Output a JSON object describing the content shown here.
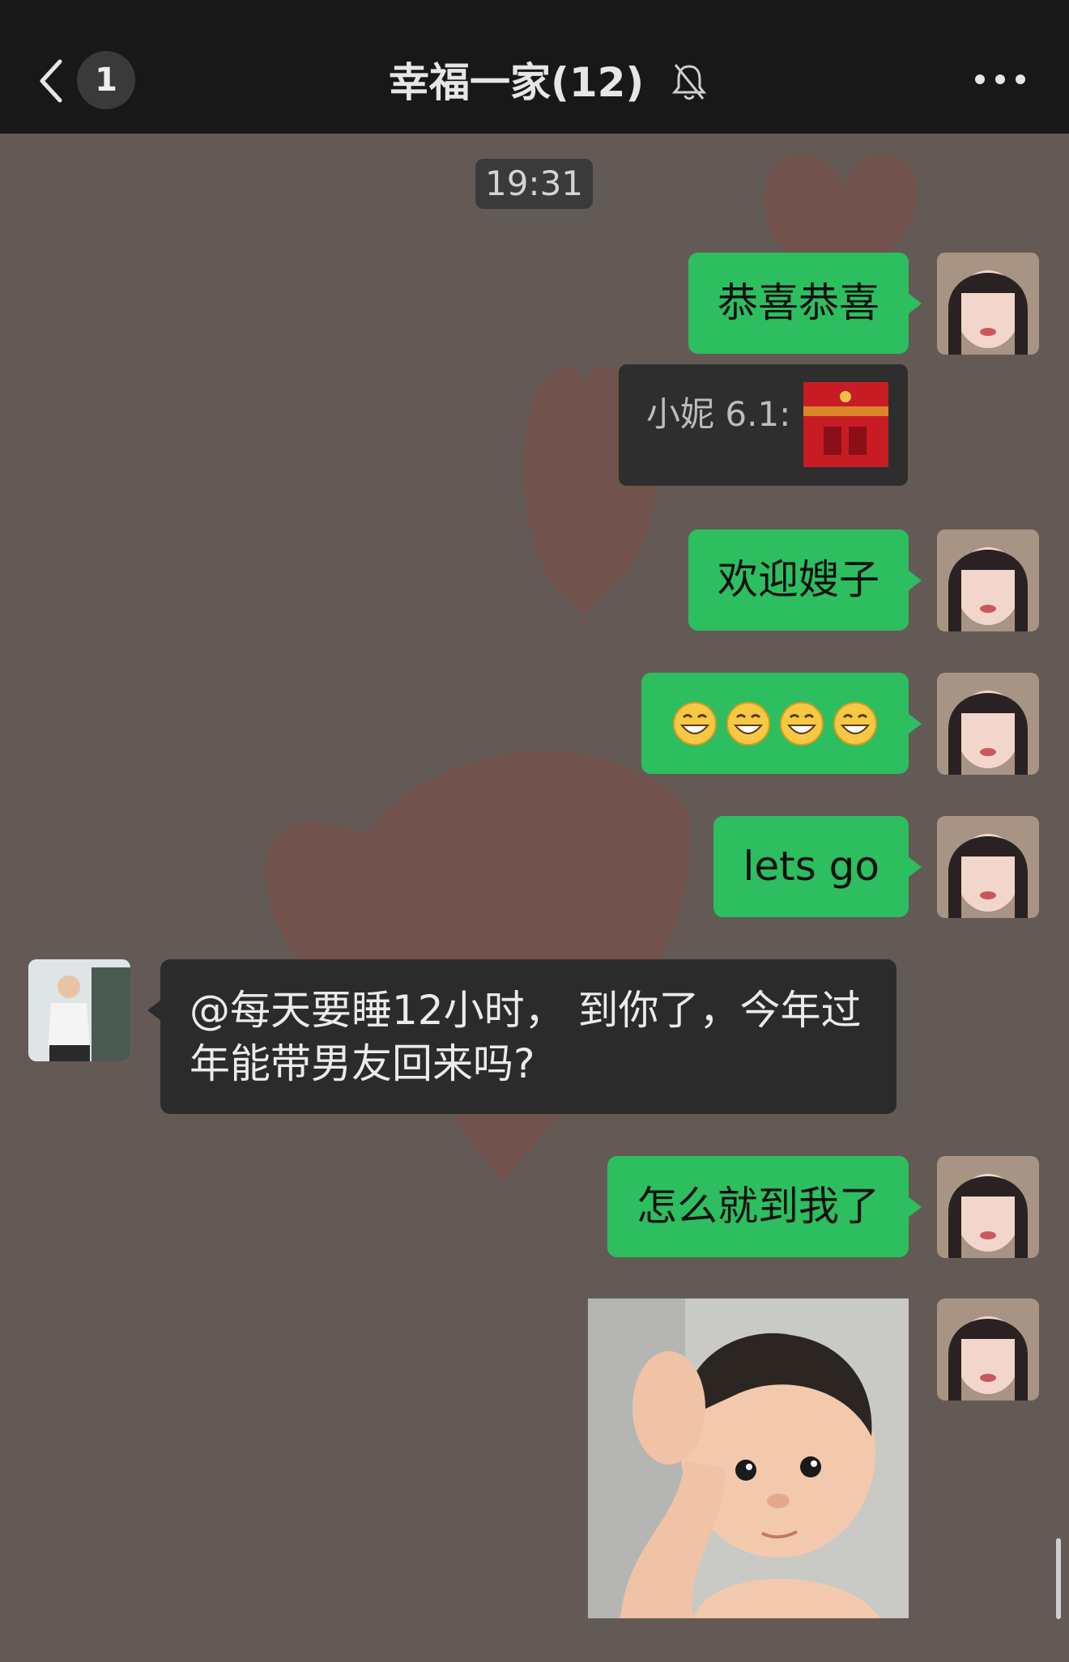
{
  "header": {
    "back_icon": "chevron-left-icon",
    "unread_count": "1",
    "title": "幸福一家(12)",
    "mute_icon": "bell-muted-icon",
    "more_icon": "ellipsis-icon"
  },
  "timestamp": "19:31",
  "messages": {
    "m1": {
      "sender": "self",
      "text": "恭喜恭喜"
    },
    "quote": {
      "text": "小妮 6.1:",
      "thumbnail_icon": "marriage-certificate-photo"
    },
    "m2": {
      "sender": "self",
      "text": "欢迎嫂子"
    },
    "m3": {
      "sender": "self",
      "emoji": [
        "grin-emoji",
        "grin-emoji",
        "grin-emoji",
        "grin-emoji"
      ]
    },
    "m4": {
      "sender": "self",
      "text": "lets go"
    },
    "m5": {
      "sender": "other",
      "text": "@每天要睡12小时， 到你了，今年过年能带男友回来吗?"
    },
    "m6": {
      "sender": "self",
      "text": "怎么就到我了"
    },
    "m7": {
      "sender": "self",
      "sticker": "baby-scratching-head-sticker"
    }
  },
  "colors": {
    "header_bg": "#181818",
    "chat_bg": "#645a55",
    "self_bubble": "#2dbe5f",
    "other_bubble": "#2b2b2b",
    "heart": "#8a4a42"
  }
}
